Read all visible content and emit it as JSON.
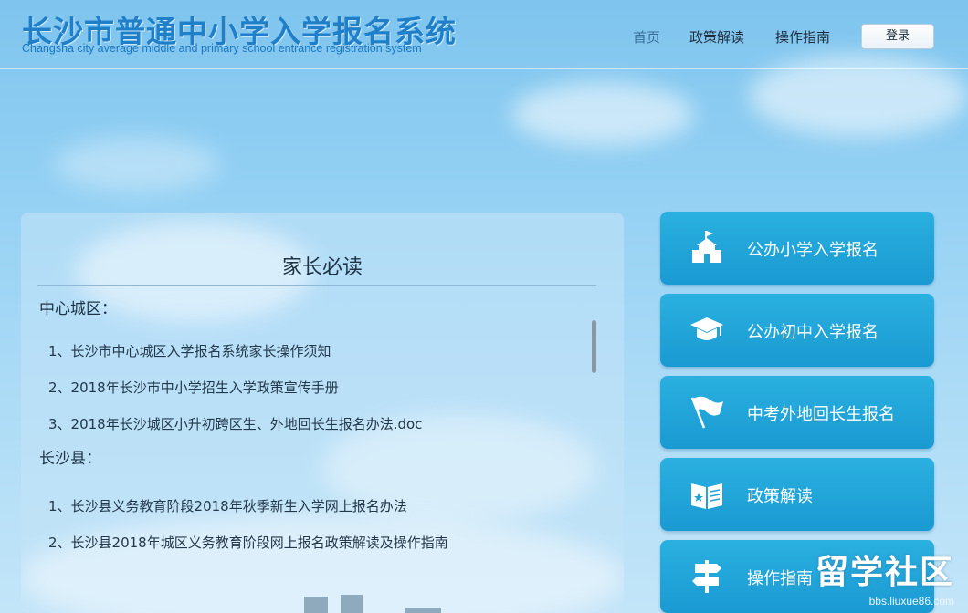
{
  "header": {
    "title": "长沙市普通中小学入学报名系统",
    "subtitle": "Changsha city average middle and primary school entrance registration system",
    "nav": [
      {
        "label": "首页"
      },
      {
        "label": "政策解读"
      },
      {
        "label": "操作指南"
      }
    ],
    "login_label": "登录"
  },
  "panel": {
    "title": "家长必读",
    "sections": [
      {
        "heading": "中心城区：",
        "items": [
          "1、长沙市中心城区入学报名系统家长操作须知",
          "2、2018年长沙市中小学招生入学政策宣传手册",
          "3、2018年长沙城区小升初跨区生、外地回长生报名办法.doc"
        ]
      },
      {
        "heading": "长沙县：",
        "items": [
          "1、长沙县义务教育阶段2018年秋季新生入学网上报名办法",
          "2、长沙县2018年城区义务教育阶段网上报名政策解读及操作指南"
        ]
      }
    ]
  },
  "side_buttons": [
    {
      "label": "公办小学入学报名",
      "icon": "school-building-icon"
    },
    {
      "label": "公办初中入学报名",
      "icon": "graduation-cap-icon"
    },
    {
      "label": "中考外地回长生报名",
      "icon": "flag-icon"
    },
    {
      "label": "政策解读",
      "icon": "open-book-icon"
    },
    {
      "label": "操作指南",
      "icon": "signpost-icon"
    }
  ],
  "watermark": {
    "text": "留学社区",
    "url": "bbs.liuxue86.com"
  },
  "colors": {
    "brand_blue": "#1f7fc9",
    "button_blue": "#1a9ad2",
    "sky": "#93d0f3"
  }
}
